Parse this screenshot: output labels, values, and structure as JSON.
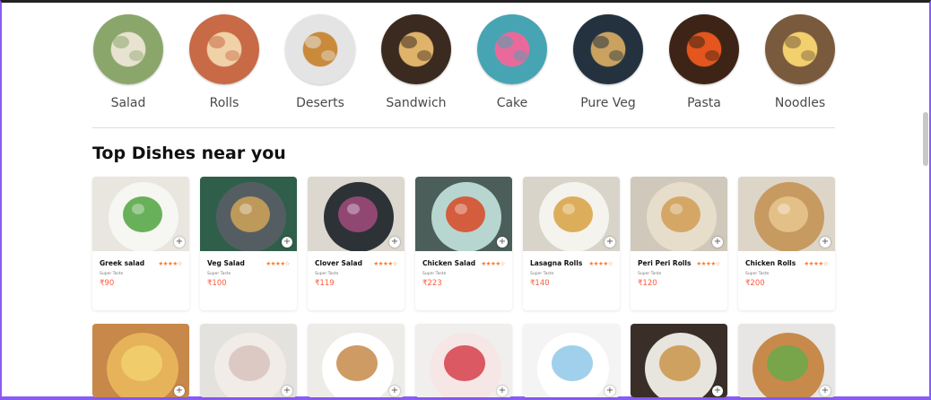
{
  "categories": [
    {
      "label": "Salad",
      "icon": "salad-icon",
      "bg": "#8aa66a",
      "accent": "#e8e2d0"
    },
    {
      "label": "Rolls",
      "icon": "rolls-icon",
      "bg": "#c76a45",
      "accent": "#f0d1a8"
    },
    {
      "label": "Deserts",
      "icon": "waffle-icon",
      "bg": "#e4e4e4",
      "accent": "#c98a3a"
    },
    {
      "label": "Sandwich",
      "icon": "sandwich-icon",
      "bg": "#3b2a1f",
      "accent": "#e0b36a"
    },
    {
      "label": "Cake",
      "icon": "cake-icon",
      "bg": "#47a4b3",
      "accent": "#e96a9a"
    },
    {
      "label": "Pure Veg",
      "icon": "veg-plate-icon",
      "bg": "#243240",
      "accent": "#c9a260"
    },
    {
      "label": "Pasta",
      "icon": "pasta-icon",
      "bg": "#3d2416",
      "accent": "#e4561e"
    },
    {
      "label": "Noodles",
      "icon": "noodles-icon",
      "bg": "#7a5a3d",
      "accent": "#f2d06e"
    }
  ],
  "section_title": "Top Dishes near you",
  "dishes": [
    {
      "name": "Greek salad",
      "shop": "Super Taste",
      "price": "₹90",
      "stars": "★★★★☆",
      "bg": "#e9e6e0",
      "plate": "#f6f6f2",
      "food": "#5aa84a"
    },
    {
      "name": "Veg Salad",
      "shop": "Super Taste",
      "price": "₹100",
      "stars": "★★★★☆",
      "bg": "#2f5f4a",
      "plate": "#545e62",
      "food": "#c9a05a"
    },
    {
      "name": "Clover Salad",
      "shop": "Super Taste",
      "price": "₹119",
      "stars": "★★★★☆",
      "bg": "#dcd8d0",
      "plate": "#2d3236",
      "food": "#9b4a7a"
    },
    {
      "name": "Chicken Salad",
      "shop": "Super Taste",
      "price": "₹223",
      "stars": "★★★★☆",
      "bg": "#4c5e5a",
      "plate": "#b7d6cf",
      "food": "#d6502c"
    },
    {
      "name": "Lasagna Rolls",
      "shop": "Super Taste",
      "price": "₹140",
      "stars": "★★★★☆",
      "bg": "#d9d4ca",
      "plate": "#f5f3ee",
      "food": "#d9a64a"
    },
    {
      "name": "Peri Peri Rolls",
      "shop": "Super Taste",
      "price": "₹120",
      "stars": "★★★★☆",
      "bg": "#cfc8bb",
      "plate": "#e6ddcb",
      "food": "#d3a15c"
    },
    {
      "name": "Chicken Rolls",
      "shop": "Super Taste",
      "price": "₹200",
      "stars": "★★★★☆",
      "bg": "#ddd6c8",
      "plate": "#c79a62",
      "food": "#e6c48c"
    }
  ],
  "dishes_row2": [
    {
      "bg": "#c7884a",
      "plate": "#e6b35a",
      "food": "#f2d06e"
    },
    {
      "bg": "#e4e2df",
      "plate": "#f2ece8",
      "food": "#d9c3bd"
    },
    {
      "bg": "#eeece8",
      "plate": "#ffffff",
      "food": "#c78a4a"
    },
    {
      "bg": "#f1efee",
      "plate": "#f6e6e6",
      "food": "#d6404a"
    },
    {
      "bg": "#f4f4f4",
      "plate": "#ffffff",
      "food": "#8fc8e8"
    },
    {
      "bg": "#3a2f28",
      "plate": "#e8e4de",
      "food": "#c9954a"
    },
    {
      "bg": "#e8e6e4",
      "plate": "#c78a4a",
      "food": "#6aa84a"
    }
  ]
}
